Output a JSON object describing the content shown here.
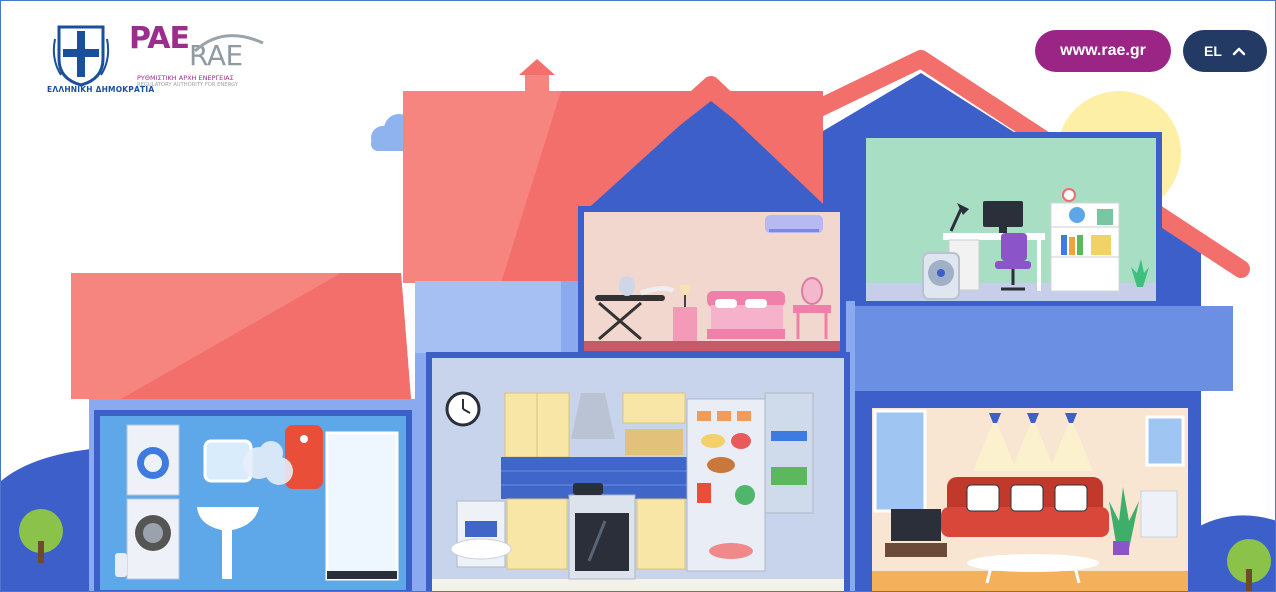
{
  "header": {
    "gov_label": "ΕΛΛΗΝΙΚΗ ΔΗΜΟΚΡΑΤΙΑ",
    "logo_greek": "PAE",
    "logo_latin": "RAE",
    "logo_subtitle_gr": "ΡΥΘΜΙΣΤΙΚΗ ΑΡΧΗ ΕΝΕΡΓΕΙΑΣ",
    "logo_subtitle_en": "REGULATORY AUTHORITY FOR ENERGY",
    "site_link": "www.rae.gr",
    "language": "EL"
  },
  "colors": {
    "roof": "#f36f6b",
    "wall_blue": "#4a6fd8",
    "light_blue": "#8aa9ef",
    "brand_purple": "#9b2584",
    "lang_navy": "#233b64",
    "sun": "#fdf0a6"
  },
  "icons": {
    "coat": "greek-coat-of-arms-icon",
    "chevron": "chevron-up-icon"
  }
}
